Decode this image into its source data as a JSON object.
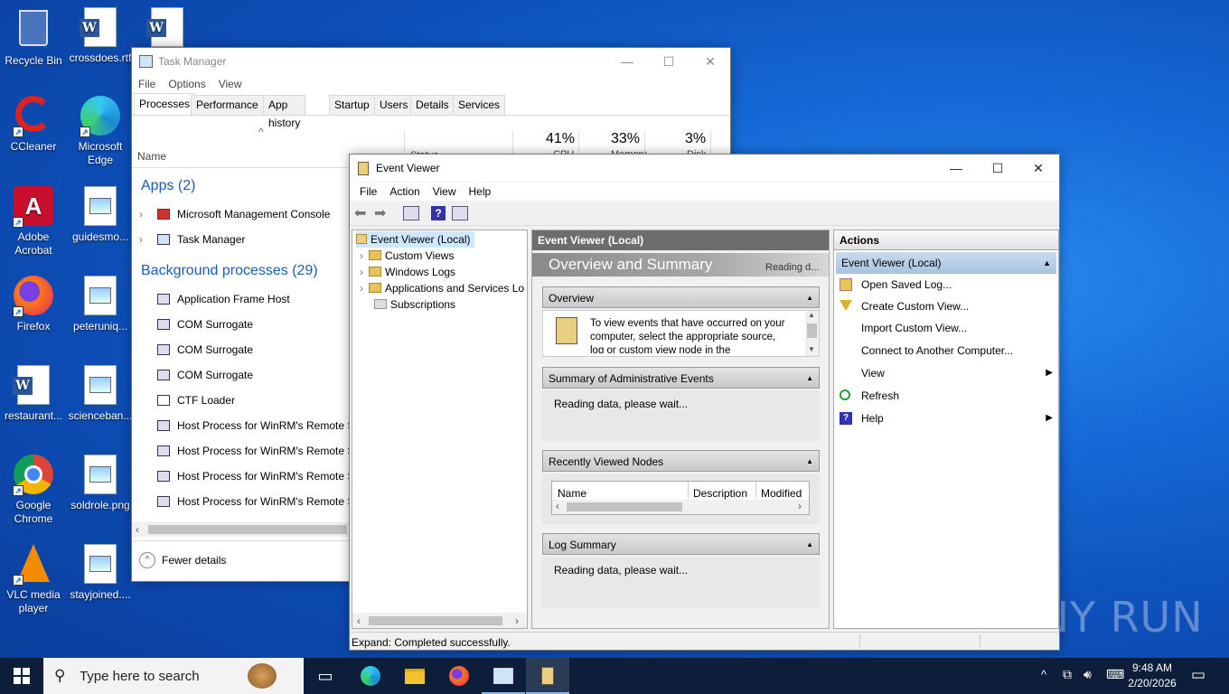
{
  "desktop": {
    "icons": [
      {
        "label": "Recycle Bin"
      },
      {
        "label": "crossdoes.rtf"
      },
      {
        "label": "CCleaner"
      },
      {
        "label": "Microsoft Edge"
      },
      {
        "label": "Adobe Acrobat"
      },
      {
        "label": "guidesmo..."
      },
      {
        "label": "Firefox"
      },
      {
        "label": "peteruniq..."
      },
      {
        "label": "restaurant..."
      },
      {
        "label": "scienceban..."
      },
      {
        "label": "Google Chrome"
      },
      {
        "label": "soldrole.png"
      },
      {
        "label": "VLC media player"
      },
      {
        "label": "stayjoined...."
      }
    ],
    "watermark": "ANY RUN"
  },
  "task_manager": {
    "title": "Task Manager",
    "menu": [
      "File",
      "Options",
      "View"
    ],
    "tabs": [
      "Processes",
      "Performance",
      "App history",
      "Startup",
      "Users",
      "Details",
      "Services"
    ],
    "columns": {
      "name": "Name",
      "status": "Status",
      "cpu_pct": "41%",
      "cpu": "CPU",
      "mem_pct": "33%",
      "mem": "Memory",
      "disk_pct": "3%",
      "disk": "Disk"
    },
    "apps_header": "Apps (2)",
    "apps": [
      "Microsoft Management Console",
      "Task Manager"
    ],
    "bg_header": "Background processes (29)",
    "bg": [
      "Application Frame Host",
      "COM Surrogate",
      "COM Surrogate",
      "COM Surrogate",
      "CTF Loader",
      "Host Process for WinRM's Remote S",
      "Host Process for WinRM's Remote S",
      "Host Process for WinRM's Remote S",
      "Host Process for WinRM's Remote S"
    ],
    "fewer_details": "Fewer details"
  },
  "event_viewer": {
    "title": "Event Viewer",
    "menu": [
      "File",
      "Action",
      "View",
      "Help"
    ],
    "tree": {
      "root": "Event Viewer (Local)",
      "items": [
        "Custom Views",
        "Windows Logs",
        "Applications and Services Lo",
        "Subscriptions"
      ]
    },
    "center": {
      "header": "Event Viewer (Local)",
      "banner": "Overview and Summary",
      "banner_status": "Reading d...",
      "overview": {
        "title": "Overview",
        "text": "To view events that have occurred on your computer, select the appropriate source, log or custom view node in the"
      },
      "admin_events": {
        "title": "Summary of Administrative Events",
        "text": "Reading data, please wait..."
      },
      "recent": {
        "title": "Recently Viewed Nodes",
        "cols": [
          "Name",
          "Description",
          "Modified"
        ]
      },
      "log_summary": {
        "title": "Log Summary",
        "text": "Reading data, please wait..."
      }
    },
    "actions": {
      "header": "Actions",
      "group": "Event Viewer (Local)",
      "items": [
        "Open Saved Log...",
        "Create Custom View...",
        "Import Custom View...",
        "Connect to Another Computer...",
        "View",
        "Refresh",
        "Help"
      ]
    },
    "status": "Expand:  Completed successfully."
  },
  "taskbar": {
    "search_placeholder": "Type here to search",
    "time": "9:48 AM",
    "date": "2/20/2026"
  }
}
